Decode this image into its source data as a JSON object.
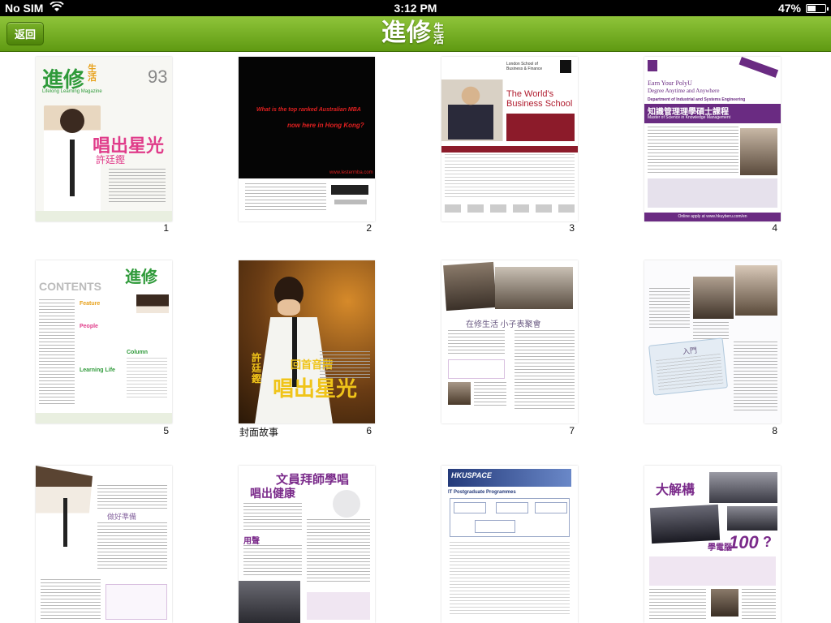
{
  "status": {
    "carrier": "No SIM",
    "time": "3:12 PM",
    "battery_text": "47%",
    "battery_level": 0.47
  },
  "nav": {
    "back_label": "返回",
    "logo_main": "進修",
    "logo_sub": "生活"
  },
  "pages": [
    {
      "number": "1",
      "cover_logo": "進修",
      "cover_logo_sub": "生活",
      "cover_subtitle": "Lifelong Learning Magazine",
      "issue": "93",
      "headline_small": "唱出星光",
      "headline_name": "許廷鏗"
    },
    {
      "number": "2",
      "ad_line1": "What is the top ranked Australian MBA",
      "ad_line2": "now here in Hong Kong?",
      "ad_url": "www.lestermba.com"
    },
    {
      "number": "3",
      "school": "London School of Business & Finance",
      "banner": "The World's Business School"
    },
    {
      "number": "4",
      "headline1": "Earn Your PolyU",
      "headline2": "Degree Anytime and Anywhere",
      "dept": "Department of Industrial and Systems Engineering",
      "program_zh": "知識管理理學碩士課程",
      "program_en": "Master of Science in Knowledge Management",
      "footer": "Online apply at www.hkuyberu.com/en"
    },
    {
      "number": "5",
      "title": "CONTENTS",
      "logo": "進修",
      "sections": [
        "Feature",
        "People",
        "Column",
        "Learning Life"
      ]
    },
    {
      "number": "6",
      "caption": "封面故事",
      "headline": "唱出星光",
      "subhead": "回首音階",
      "name": "許廷鏗"
    },
    {
      "number": "7",
      "headline": "在修生活 小子表聚會"
    },
    {
      "number": "8",
      "box_title": "入門"
    },
    {
      "number": "9",
      "side_title": "做好準備"
    },
    {
      "number": "10",
      "headline1": "文員拜師學唱",
      "headline2": "唱出健康",
      "subhead": "用聲"
    },
    {
      "number": "11",
      "brand": "HKUSPACE",
      "title": "IT Postgraduate Programmes"
    },
    {
      "number": "12",
      "headline": "大解構",
      "subhead": "學電腦",
      "big_number": "100",
      "suffix": "?"
    }
  ],
  "colors": {
    "nav_green": "#6ea81f",
    "magazine_green": "#2f9a3a",
    "magazine_orange": "#e8a11a",
    "ad_red": "#e02020",
    "polyu_purple": "#6a2b82",
    "hkuspace_blue": "#243a7a"
  }
}
